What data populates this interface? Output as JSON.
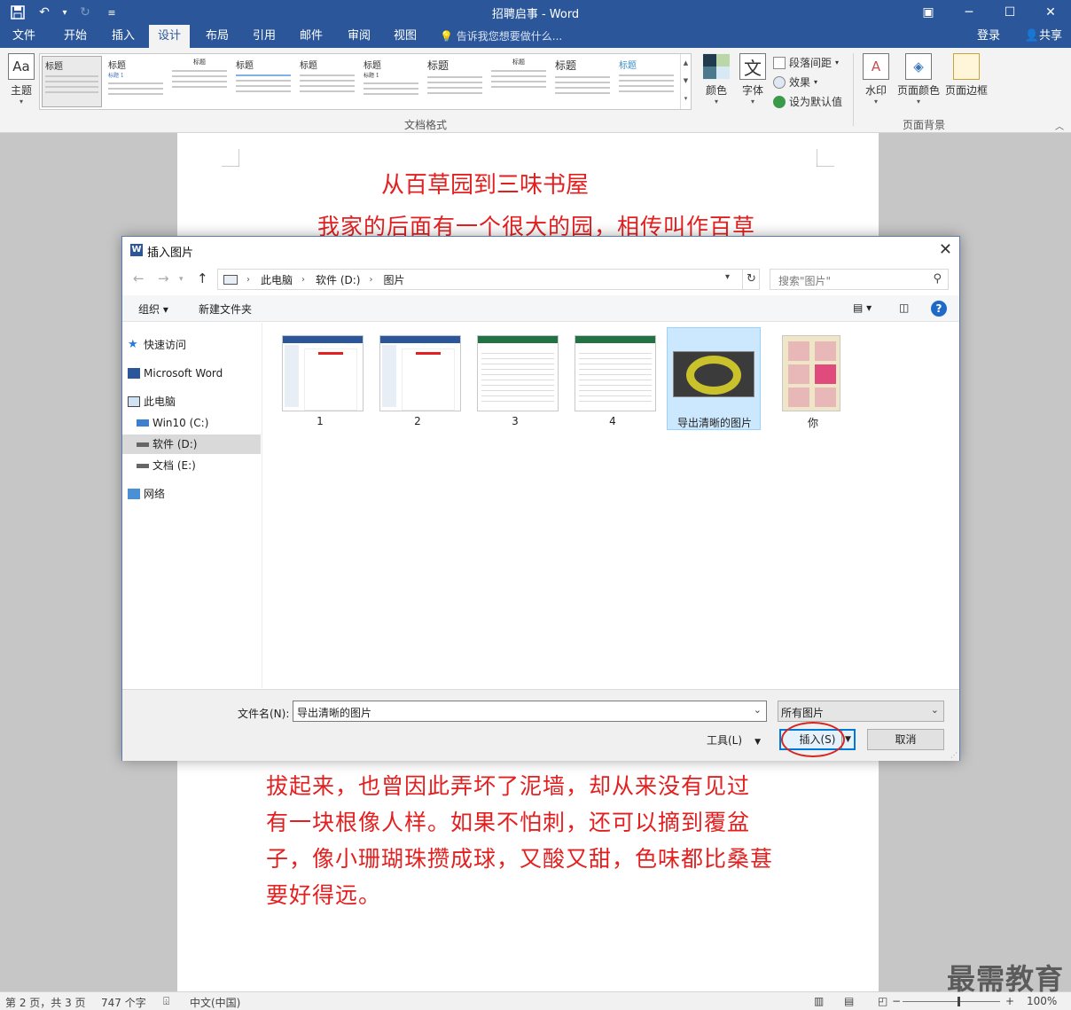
{
  "app": {
    "title": "招聘启事 - Word",
    "qat_dropdown": "▾",
    "customize": "≡"
  },
  "tabs": [
    "文件",
    "开始",
    "插入",
    "设计",
    "布局",
    "引用",
    "邮件",
    "审阅",
    "视图"
  ],
  "tellme": "告诉我您想要做什么...",
  "login": "登录",
  "share": "共享",
  "ribbon": {
    "theme": "主题",
    "gallery_heading": "标题",
    "gallery_sub": "标题 1",
    "group_doc_format": "文档格式",
    "colors": "颜色",
    "fonts": "字体",
    "fonts_glyph": "文",
    "paragraph_spacing": "段落间距",
    "effects": "效果",
    "set_default": "设为默认值",
    "watermark": "水印",
    "page_color": "页面颜色",
    "page_borders": "页面边框",
    "group_page_bg": "页面背景"
  },
  "document": {
    "title": "从百草园到三味书屋",
    "first_line": "我家的后面有一个很大的园，相传叫作百草",
    "body_lines": [
      "拔起来，也曾因此弄坏了泥墙，却从来没有见过",
      "有一块根像人样。如果不怕刺，还可以摘到覆盆",
      "子，像小珊瑚珠攒成球，又酸又甜，色味都比桑葚",
      "要好得远。"
    ]
  },
  "dialog": {
    "title": "插入图片",
    "breadcrumb": [
      "此电脑",
      "软件 (D:)",
      "图片"
    ],
    "search_placeholder": "搜索\"图片\"",
    "organize": "组织 ▾",
    "new_folder": "新建文件夹",
    "nav": {
      "quick_access": "快速访问",
      "word": "Microsoft Word",
      "this_pc": "此电脑",
      "c_drive": "Win10 (C:)",
      "d_drive": "软件 (D:)",
      "e_drive": "文档 (E:)",
      "network": "网络"
    },
    "files": [
      "1",
      "2",
      "3",
      "4",
      "导出清晰的图片",
      "你"
    ],
    "filename_label": "文件名(N):",
    "filename_value": "导出清晰的图片",
    "filetype": "所有图片",
    "tools": "工具(L)",
    "insert": "插入(S)",
    "cancel": "取消"
  },
  "status": {
    "page": "第 2 页，共 3 页",
    "words": "747 个字",
    "lang": "中文(中国)",
    "zoom": "100%"
  },
  "watermark_text": "最需教育"
}
